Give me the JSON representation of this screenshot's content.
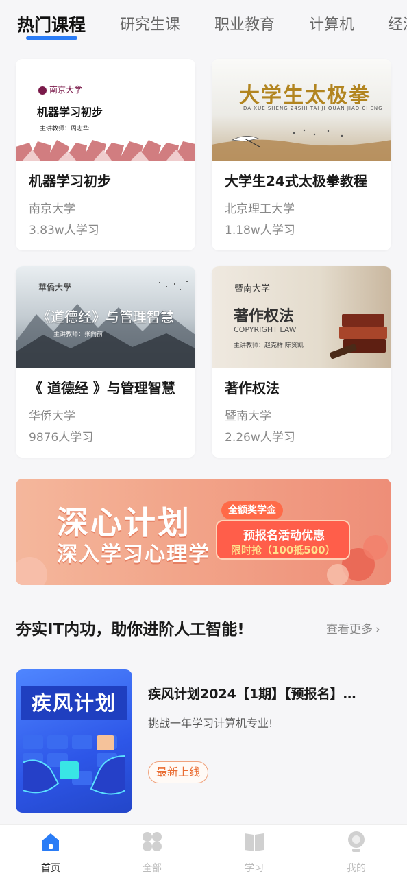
{
  "tabs": [
    {
      "label": "热门课程",
      "active": true
    },
    {
      "label": "研究生课",
      "active": false
    },
    {
      "label": "职业教育",
      "active": false
    },
    {
      "label": "计算机",
      "active": false
    },
    {
      "label": "经济",
      "active": false
    }
  ],
  "courses": [
    {
      "title": "机器学习初步",
      "school": "南京大学",
      "learners": "3.83w人学习",
      "cover": {
        "logo": "南京大学",
        "title": "机器学习初步",
        "teacher": "主讲教师：周志华"
      }
    },
    {
      "title": "大学生24式太极拳教程",
      "school": "北京理工大学",
      "learners": "1.18w人学习",
      "cover": {
        "title": "大学生太极拳",
        "pinyin": "DA XUE SHENG 24SHI TAI JI QUAN JIAO CHENG"
      }
    },
    {
      "title": "《 道德经 》与管理智慧",
      "school": "华侨大学",
      "learners": "9876人学习",
      "cover": {
        "logo": "華僑大學",
        "title": "《道德经》与管理智慧",
        "teacher": "主讲教师：张向前"
      }
    },
    {
      "title": "著作权法",
      "school": "暨南大学",
      "learners": "2.26w人学习",
      "cover": {
        "logo": "暨南大学",
        "title": "著作权法",
        "subtitle": "COPYRIGHT LAW",
        "teacher": "主讲教师：赵克祥 陈贤凯"
      }
    }
  ],
  "banner": {
    "line1": "深心计划",
    "line2": "深入学习心理学",
    "pill": "全额奖学金",
    "promo": "预报名活动优惠",
    "deal": "限时抢（100抵500）"
  },
  "section": {
    "title": "夯实IT内功，助你进阶人工智能!",
    "see_more": "查看更多",
    "featured": {
      "cover_text": "疾风计划",
      "title": "疾风计划2024【1期】【预报名】…",
      "subtitle": "挑战一年学习计算机专业!",
      "badge": "最新上线"
    }
  },
  "nav": [
    {
      "label": "首页",
      "icon": "home-icon",
      "active": true
    },
    {
      "label": "全部",
      "icon": "grid-icon",
      "active": false
    },
    {
      "label": "学习",
      "icon": "book-icon",
      "active": false
    },
    {
      "label": "我的",
      "icon": "profile-icon",
      "active": false
    }
  ],
  "colors": {
    "accent": "#2a7cf6",
    "badge": "#e96d33",
    "banner": "#f2a489"
  }
}
